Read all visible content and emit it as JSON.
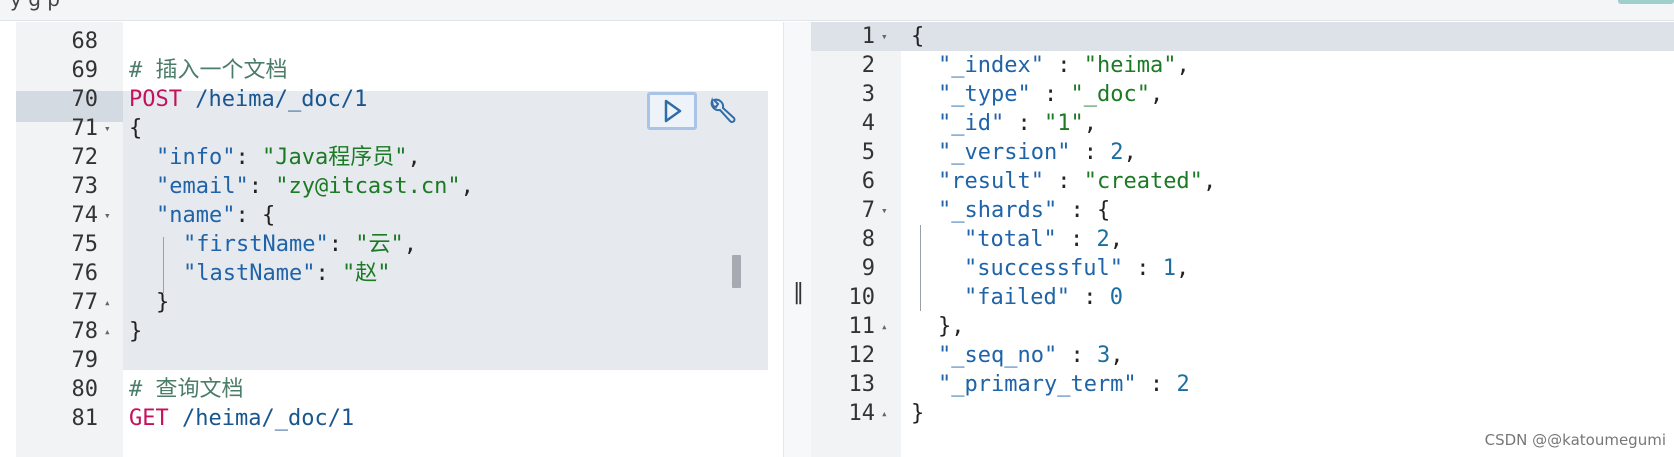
{
  "topbar": {
    "partial_text": "y    g    p"
  },
  "request": {
    "lines": [
      {
        "n": "68",
        "text": ""
      },
      {
        "n": "69",
        "comment": "# 插入一个文档"
      },
      {
        "n": "70",
        "method": "POST",
        "path": " /heima/_doc/1"
      },
      {
        "n": "71",
        "fold": "▾",
        "punc": "{"
      },
      {
        "n": "72",
        "key": "\"info\"",
        "sep": ": ",
        "str": "\"Java程序员\"",
        "tail": ","
      },
      {
        "n": "73",
        "key": "\"email\"",
        "sep": ": ",
        "str": "\"zy@itcast.cn\"",
        "tail": ","
      },
      {
        "n": "74",
        "fold": "▾",
        "key": "\"name\"",
        "sep": ": ",
        "tail": "{"
      },
      {
        "n": "75",
        "key": "\"firstName\"",
        "sep": ": ",
        "str": "\"云\"",
        "tail": ","
      },
      {
        "n": "76",
        "key": "\"lastName\"",
        "sep": ": ",
        "str": "\"赵\""
      },
      {
        "n": "77",
        "fold": "▴",
        "punc": "}"
      },
      {
        "n": "78",
        "fold": "▴",
        "punc": "}"
      },
      {
        "n": "79",
        "text": ""
      },
      {
        "n": "80",
        "comment": "# 查询文档"
      },
      {
        "n": "81",
        "method": "GET",
        "path": " /heima/_doc/1"
      }
    ]
  },
  "controls": {
    "run_icon": "play-triangle-icon",
    "wrench_icon": "wrench-icon",
    "splitter_glyph": "‖"
  },
  "response": {
    "lines": [
      {
        "n": "1",
        "fold": "▾",
        "punc": "{"
      },
      {
        "n": "2",
        "key": "\"_index\"",
        "sep": " : ",
        "str": "\"heima\"",
        "tail": ","
      },
      {
        "n": "3",
        "key": "\"_type\"",
        "sep": " : ",
        "str": "\"_doc\"",
        "tail": ","
      },
      {
        "n": "4",
        "key": "\"_id\"",
        "sep": " : ",
        "str": "\"1\"",
        "tail": ","
      },
      {
        "n": "5",
        "key": "\"_version\"",
        "sep": " : ",
        "num": "2",
        "tail": ","
      },
      {
        "n": "6",
        "key": "\"result\"",
        "sep": " : ",
        "str": "\"created\"",
        "tail": ","
      },
      {
        "n": "7",
        "fold": "▾",
        "key": "\"_shards\"",
        "sep": " : ",
        "tail": "{"
      },
      {
        "n": "8",
        "key": "\"total\"",
        "sep": " : ",
        "num": "2",
        "tail": ","
      },
      {
        "n": "9",
        "key": "\"successful\"",
        "sep": " : ",
        "num": "1",
        "tail": ","
      },
      {
        "n": "10",
        "key": "\"failed\"",
        "sep": " : ",
        "num": "0"
      },
      {
        "n": "11",
        "fold": "▴",
        "punc": "},"
      },
      {
        "n": "12",
        "key": "\"_seq_no\"",
        "sep": " : ",
        "num": "3",
        "tail": ","
      },
      {
        "n": "13",
        "key": "\"_primary_term\"",
        "sep": " : ",
        "num": "2"
      },
      {
        "n": "14",
        "fold": "▴",
        "punc": "}"
      }
    ]
  },
  "watermark": "CSDN @@katoumegumi",
  "colors": {
    "method": "#c5105c",
    "string": "#1b7a24",
    "key": "#1f63a8",
    "number": "#1b6ea0",
    "comment": "#4c7d6a"
  }
}
